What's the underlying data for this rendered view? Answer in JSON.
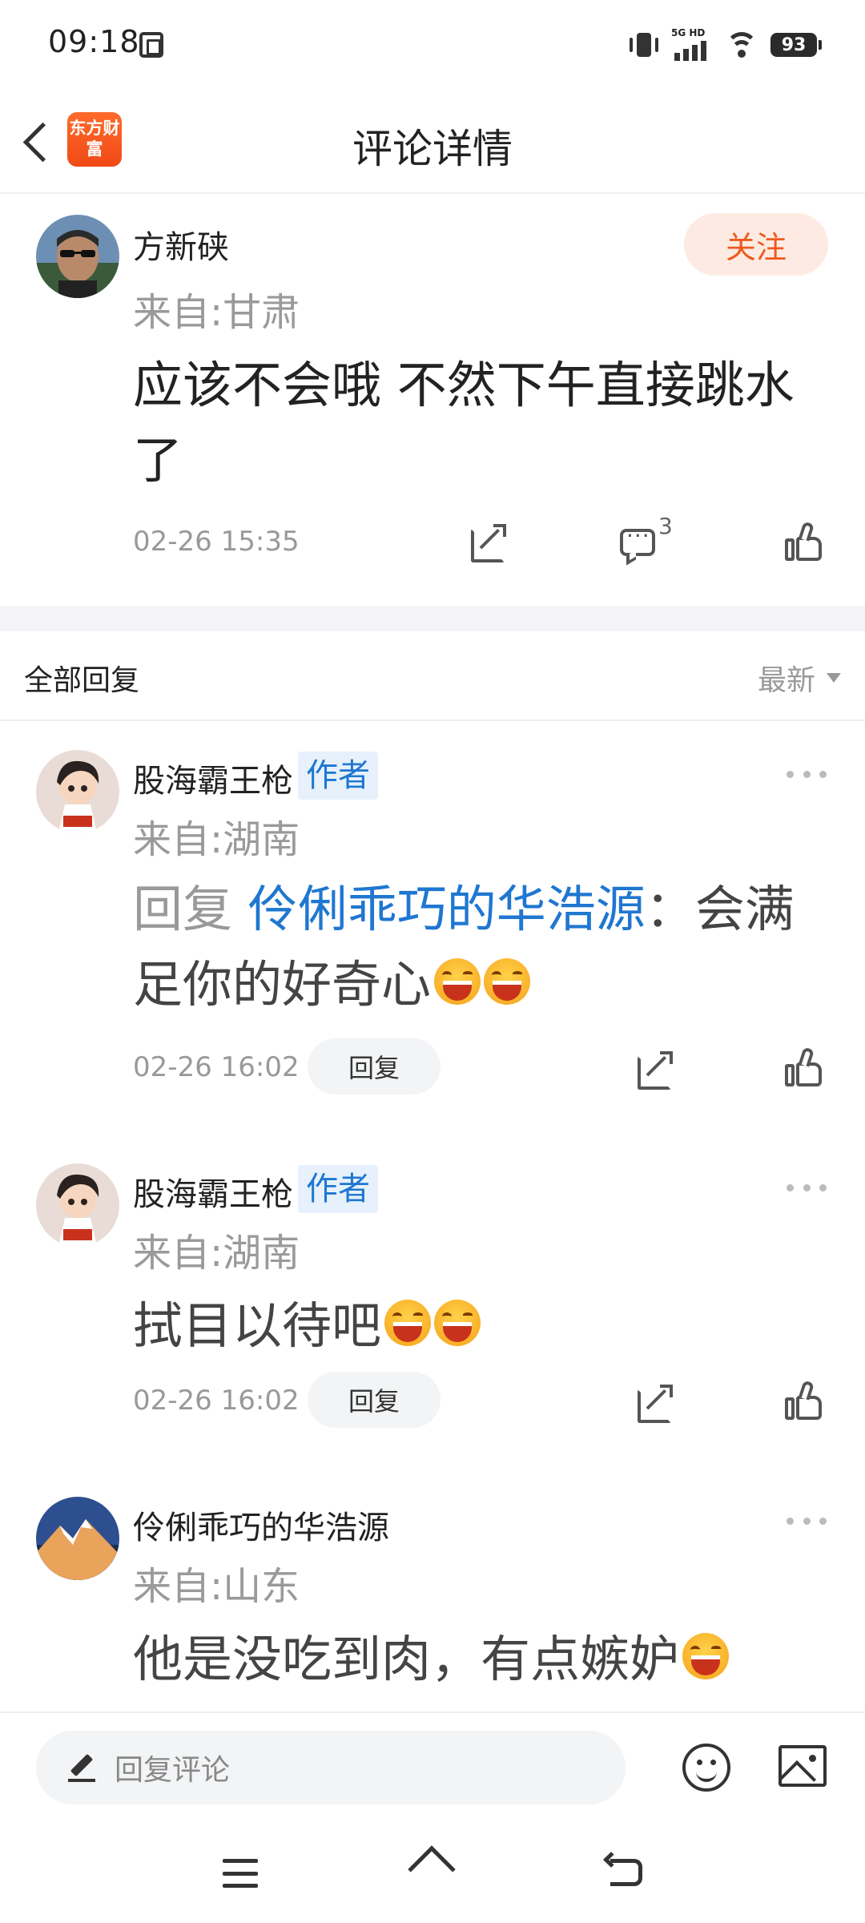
{
  "status_bar": {
    "time": "09:18",
    "network_label": "5G HD",
    "battery": "93"
  },
  "header": {
    "title": "评论详情",
    "app_logo_text": "东方财富"
  },
  "post": {
    "author": "方新硖",
    "location": "来自:甘肃",
    "follow_label": "关注",
    "content": "应该不会哦  不然下午直接跳水了",
    "time": "02-26 15:35",
    "comment_count": "3"
  },
  "replies_header": {
    "title": "全部回复",
    "sort_label": "最新"
  },
  "replies": [
    {
      "author": "股海霸王枪",
      "badge": "作者",
      "location": "来自:湖南",
      "prefix": "回复 ",
      "mention": "伶俐乖巧的华浩源",
      "text": "：会满足你的好奇心",
      "emoji": [
        "laugh",
        "laugh"
      ],
      "time": "02-26 16:02",
      "reply_label": "回复"
    },
    {
      "author": "股海霸王枪",
      "badge": "作者",
      "location": "来自:湖南",
      "text": "拭目以待吧",
      "emoji": [
        "laugh",
        "laugh"
      ],
      "time": "02-26 16:02",
      "reply_label": "回复"
    },
    {
      "author": "伶俐乖巧的华浩源",
      "location": "来自:山东",
      "text": "他是没吃到肉，有点嫉妒",
      "emoji": [
        "grin"
      ]
    }
  ],
  "input_bar": {
    "placeholder": "回复评论"
  },
  "colors": {
    "accent_orange": "#ee5a1e",
    "follow_bg": "#fdebe3",
    "mention_blue": "#1f77d1",
    "badge_bg": "#e6f1fb"
  }
}
